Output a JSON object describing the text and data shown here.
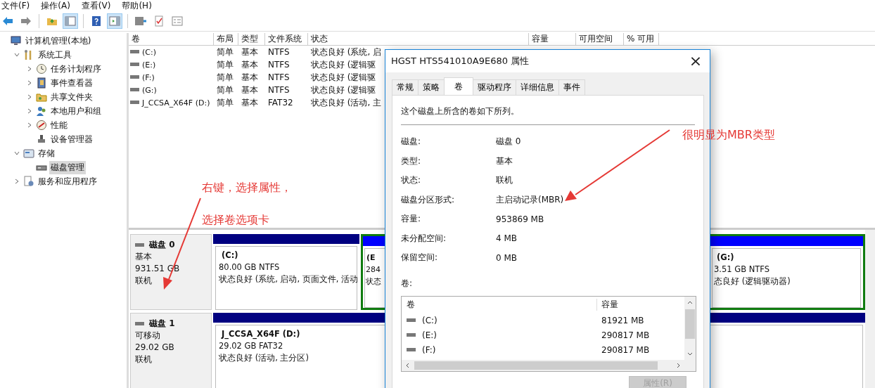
{
  "menu": [
    "文件(F)",
    "操作(A)",
    "查看(V)",
    "帮助(H)"
  ],
  "toolbar": [
    {
      "kind": "back",
      "pressed": false
    },
    {
      "kind": "forward",
      "pressed": false
    },
    {
      "kind": "sep"
    },
    {
      "kind": "up",
      "pressed": false
    },
    {
      "kind": "tree",
      "pressed": true
    },
    {
      "kind": "sep"
    },
    {
      "kind": "help",
      "pressed": false
    },
    {
      "kind": "pane",
      "pressed": true
    },
    {
      "kind": "sep"
    },
    {
      "kind": "connect",
      "pressed": false
    },
    {
      "kind": "check",
      "pressed": false
    },
    {
      "kind": "props",
      "pressed": false
    }
  ],
  "tree": [
    {
      "label": "计算机管理(本地)",
      "kind": "computer",
      "selected": false,
      "children": [
        {
          "label": "系统工具",
          "kind": "tools",
          "expanded": true,
          "selected": false,
          "children": [
            {
              "label": "任务计划程序",
              "kind": "clock",
              "expanded": false,
              "selected": false
            },
            {
              "label": "事件查看器",
              "kind": "event",
              "expanded": false,
              "selected": false
            },
            {
              "label": "共享文件夹",
              "kind": "share",
              "expanded": false,
              "selected": false
            },
            {
              "label": "本地用户和组",
              "kind": "users",
              "expanded": false,
              "selected": false
            },
            {
              "label": "性能",
              "kind": "perf",
              "expanded": false,
              "selected": false
            },
            {
              "label": "设备管理器",
              "kind": "device",
              "selected": false
            }
          ]
        },
        {
          "label": "存储",
          "kind": "storage",
          "expanded": true,
          "selected": false,
          "children": [
            {
              "label": "磁盘管理",
              "kind": "disk",
              "selected": true
            }
          ]
        },
        {
          "label": "服务和应用程序",
          "kind": "services",
          "expanded": false,
          "selected": false
        }
      ]
    }
  ],
  "volumes": {
    "columns": [
      "卷",
      "布局",
      "类型",
      "文件系统",
      "状态",
      "容量",
      "可用空间",
      "% 可用"
    ],
    "rows": [
      [
        "(C:)",
        "简单",
        "基本",
        "NTFS",
        "状态良好 (系统, 启"
      ],
      [
        "(E:)",
        "简单",
        "基本",
        "NTFS",
        "状态良好 (逻辑驱"
      ],
      [
        "(F:)",
        "简单",
        "基本",
        "NTFS",
        "状态良好 (逻辑驱"
      ],
      [
        "(G:)",
        "简单",
        "基本",
        "NTFS",
        "状态良好 (逻辑驱"
      ],
      [
        "J_CCSA_X64F (D:)",
        "简单",
        "基本",
        "FAT32",
        "状态良好 (活动, 主"
      ]
    ]
  },
  "disks": [
    {
      "name": "磁盘 0",
      "type": "基本",
      "size": "931.51 GB",
      "status": "联机",
      "partitions": [
        {
          "kind": "primary",
          "title": "(C:)",
          "size": "80.00 GB NTFS",
          "status": "状态良好 (系统, 启动, 页面文件, 活动"
        },
        {
          "kind": "logical",
          "title": "(E",
          "size": "284",
          "status": "状态"
        },
        {
          "kind": "logical",
          "title": "(G:)",
          "size": "3.51 GB NTFS",
          "status": "态良好 (逻辑驱动器)"
        }
      ]
    },
    {
      "name": "磁盘 1",
      "type": "可移动",
      "size": "29.02 GB",
      "status": "联机",
      "partitions": [
        {
          "kind": "primary",
          "title": "J_CCSA_X64F  (D:)",
          "size": "29.02 GB FAT32",
          "status": "状态良好 (活动, 主分区)"
        }
      ]
    }
  ],
  "dialog": {
    "title": "HGST HTS541010A9E680 属性",
    "close": "×",
    "tabs": [
      {
        "label": "常规",
        "selected": false
      },
      {
        "label": "策略",
        "selected": false
      },
      {
        "label": "卷",
        "selected": true
      },
      {
        "label": "驱动程序",
        "selected": false
      },
      {
        "label": "详细信息",
        "selected": false
      },
      {
        "label": "事件",
        "selected": false
      }
    ],
    "intro": "这个磁盘上所含的卷如下所列。",
    "fields": [
      {
        "label": "磁盘:",
        "value": "磁盘 0"
      },
      {
        "label": "类型:",
        "value": "基本"
      },
      {
        "label": "状态:",
        "value": "联机"
      },
      {
        "label": "磁盘分区形式:",
        "value": "主启动记录(MBR)"
      },
      {
        "label": "容量:",
        "value": "953869 MB"
      },
      {
        "label": "未分配空间:",
        "value": "4 MB"
      },
      {
        "label": "保留空间:",
        "value": "0 MB"
      }
    ],
    "list_label": "卷:",
    "list": {
      "columns": [
        "卷",
        "容量"
      ],
      "rows": [
        {
          "name": "(C:)",
          "size": "81921 MB"
        },
        {
          "name": "(E:)",
          "size": "290817 MB"
        },
        {
          "name": "(F:)",
          "size": "290817 MB"
        }
      ]
    },
    "button": {
      "label": "属性(R)",
      "disabled": true
    }
  },
  "annotations": [
    "右键，选择属性，",
    "选择卷选项卡",
    "很明显为MBR类型"
  ]
}
